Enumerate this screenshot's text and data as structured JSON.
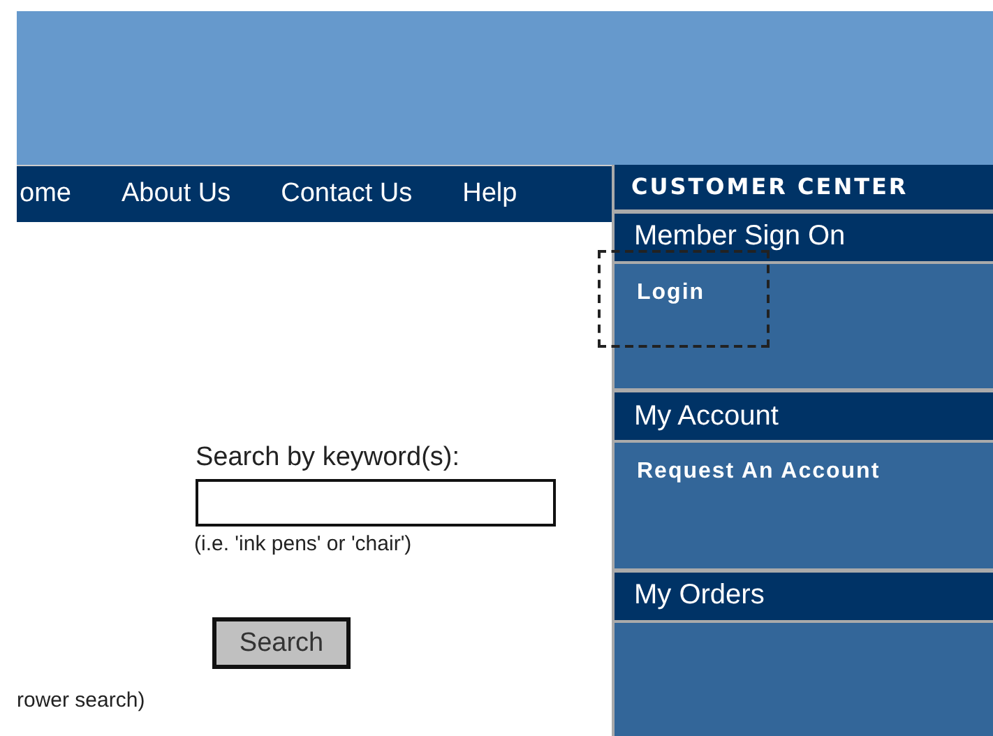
{
  "nav": [
    {
      "label": "ome"
    },
    {
      "label": "About Us"
    },
    {
      "label": "Contact Us"
    },
    {
      "label": "Help"
    }
  ],
  "search": {
    "label": "Search by keyword(s):",
    "hint": "(i.e. 'ink pens' or 'chair')",
    "button": "Search",
    "note": "rower search)"
  },
  "customer_center": {
    "title": "CUSTOMER CENTER",
    "sections": [
      {
        "title": "Member Sign On",
        "links": [
          {
            "label": "Login",
            "focused": true
          }
        ]
      },
      {
        "title": "My Account",
        "links": [
          {
            "label": "Request An Account",
            "focused": false
          }
        ]
      },
      {
        "title": "My Orders"
      }
    ]
  }
}
